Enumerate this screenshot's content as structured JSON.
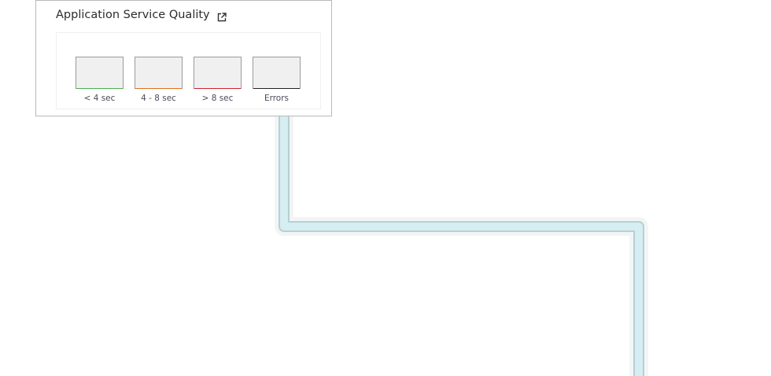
{
  "widget": {
    "title": "Application Service Quality",
    "external_link_icon": "external-link-icon",
    "tiles": [
      {
        "label": "< 4 sec",
        "bar_color": "#4caf50"
      },
      {
        "label": "4 - 8 sec",
        "bar_color": "#e07020"
      },
      {
        "label": "> 8 sec",
        "bar_color": "#d02030"
      },
      {
        "label": "Errors",
        "bar_color": "#222222"
      }
    ]
  },
  "connector": {
    "color": "#d6edf1",
    "outline_color": "#b7cfd5"
  }
}
